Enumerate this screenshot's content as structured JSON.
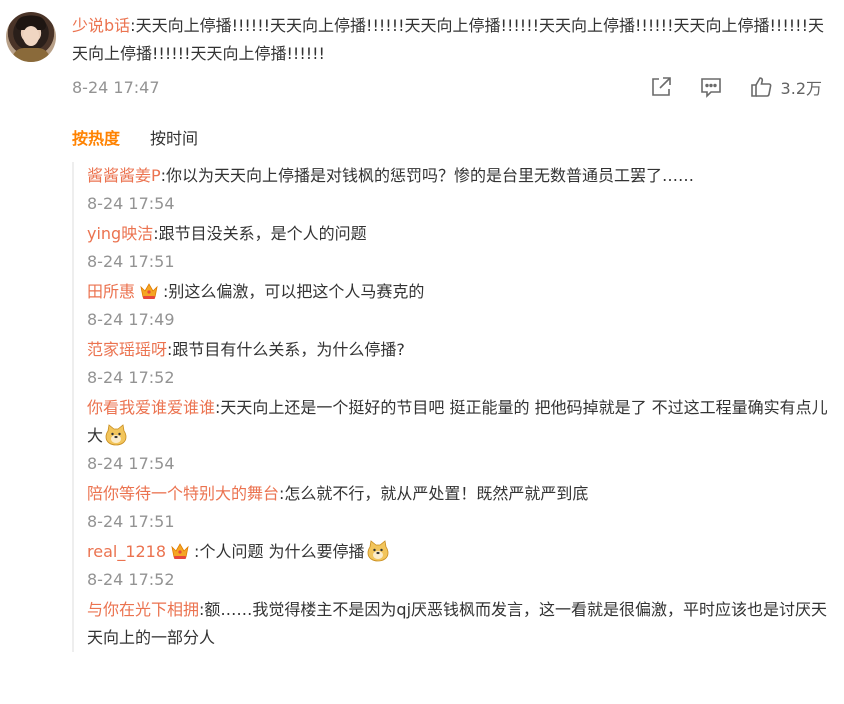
{
  "main": {
    "username": "少说b话",
    "text": ":天天向上停播!!!!!!天天向上停播!!!!!!天天向上停播!!!!!!天天向上停播!!!!!!天天向上停播!!!!!!天天向上停播!!!!!!天天向上停播!!!!!!",
    "time": "8-24 17:47",
    "like_count": "3.2万"
  },
  "sort": {
    "hot": "按热度",
    "time": "按时间"
  },
  "replies": [
    {
      "username": "酱酱酱姜P",
      "text": ":你以为天天向上停播是对钱枫的惩罚吗？惨的是台里无数普通员工罢了……",
      "time": "8-24 17:54"
    },
    {
      "username": "ying映洁",
      "text": ":跟节目没关系，是个人的问题",
      "time": "8-24 17:51"
    },
    {
      "username": "田所惠",
      "text": ":别这么偏激，可以把这个人马赛克的",
      "time": "8-24 17:49"
    },
    {
      "username": "范家瑶瑶呀",
      "text": ":跟节目有什么关系，为什么停播?",
      "time": "8-24 17:52"
    },
    {
      "username": "你看我爱谁爱谁谁",
      "text": ":天天向上还是一个挺好的节目吧 挺正能量的 把他码掉就是了 不过这工程量确实有点儿大",
      "time": "8-24 17:54"
    },
    {
      "username": "陪你等待一个特别大的舞台",
      "text": ":怎么就不行，就从严处置！既然严就严到底",
      "time": "8-24 17:51"
    },
    {
      "username": "real_1218",
      "text": ":个人问题 为什么要停播",
      "time": "8-24 17:52"
    },
    {
      "username": "与你在光下相拥",
      "text": ":额……我觉得楼主不是因为qj厌恶钱枫而发言，这一看就是很偏激，平时应该也是讨厌天天向上的一部分人",
      "time": ""
    }
  ],
  "colors": {
    "username": "#eb7350",
    "sort_active": "#ff8200",
    "time": "#939393"
  },
  "icons": [
    "share-icon",
    "comment-icon",
    "like-icon",
    "member-crown-icon",
    "doge-emoji-icon"
  ]
}
